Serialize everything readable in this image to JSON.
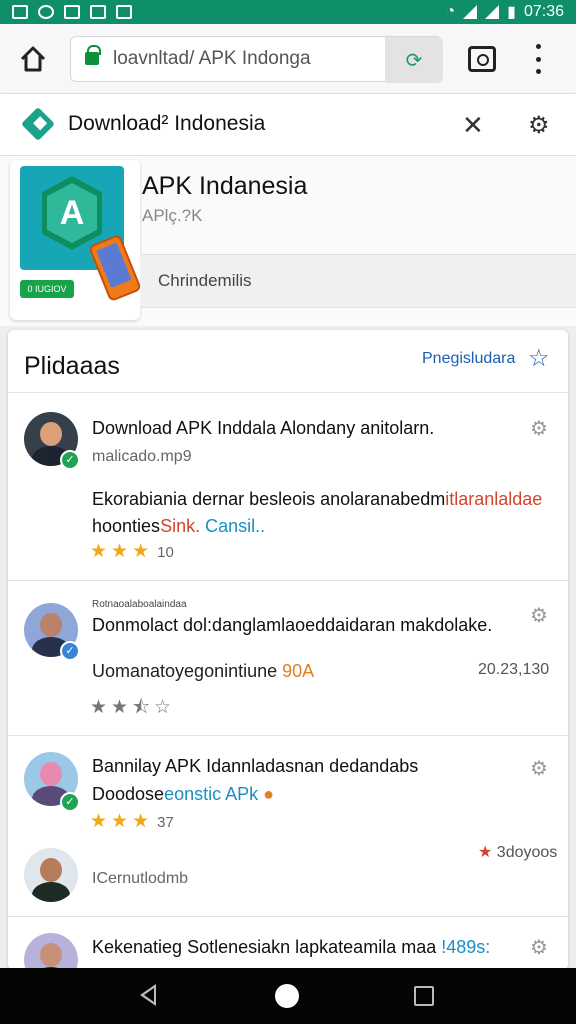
{
  "status_bar": {
    "time": "07:36",
    "icons": [
      "gmail-icon",
      "sync-icon",
      "photo-icon",
      "play-icon",
      "mail-icon",
      "wifi-icon",
      "signal-icon",
      "battery-icon"
    ]
  },
  "browser": {
    "url": "loavnltad/ APK Indonga"
  },
  "app_bar": {
    "title": "Download² Indonesia"
  },
  "app": {
    "name": "APK Indanesia",
    "subtitle": "APlç.?K",
    "badge": "0 IUGIOV",
    "icon_letter": "A",
    "category": "Chrindemilis"
  },
  "reviews": {
    "title": "Plidaaas",
    "link": "Pnegisludara",
    "items": [
      {
        "title": "Download APK Inddala Alondany anitolarn.",
        "meta": "malicado.mp9",
        "body_line1_a": "Ekorabiania dernar besleois anolaranabedm",
        "body_line1_b": "itlaranlaldae",
        "body_line2_a": "hoonties",
        "body_line2_b": "Sink.",
        "body_line2_c": "Cansil..",
        "rating": 3,
        "count": "10"
      },
      {
        "small_header": "Rotnaoalaboalaindaa",
        "title": "Donmolact dol:danglamlaoeddaidaran makdolake.",
        "meta_a": "Uomanatoyegonintiune",
        "meta_b": "90A",
        "right": "20.23,130",
        "rating": 2.5
      },
      {
        "title": "Bannilay APK Idannladasnan dedandabs",
        "line2_a": "Doodose",
        "line2_b": "eonstic APk",
        "rating": 3,
        "count": "37"
      },
      {
        "meta": "ICernutlodmb",
        "right": "3doyoos"
      },
      {
        "title": "Kekenatieg Sotlenesiakn lapkateamila maa",
        "title_b": "!489s:"
      }
    ]
  },
  "colors": {
    "status_bar": "#0e8f6a",
    "accent": "#1aa38a",
    "link": "#1a5fb4",
    "star": "#f1a71a"
  }
}
